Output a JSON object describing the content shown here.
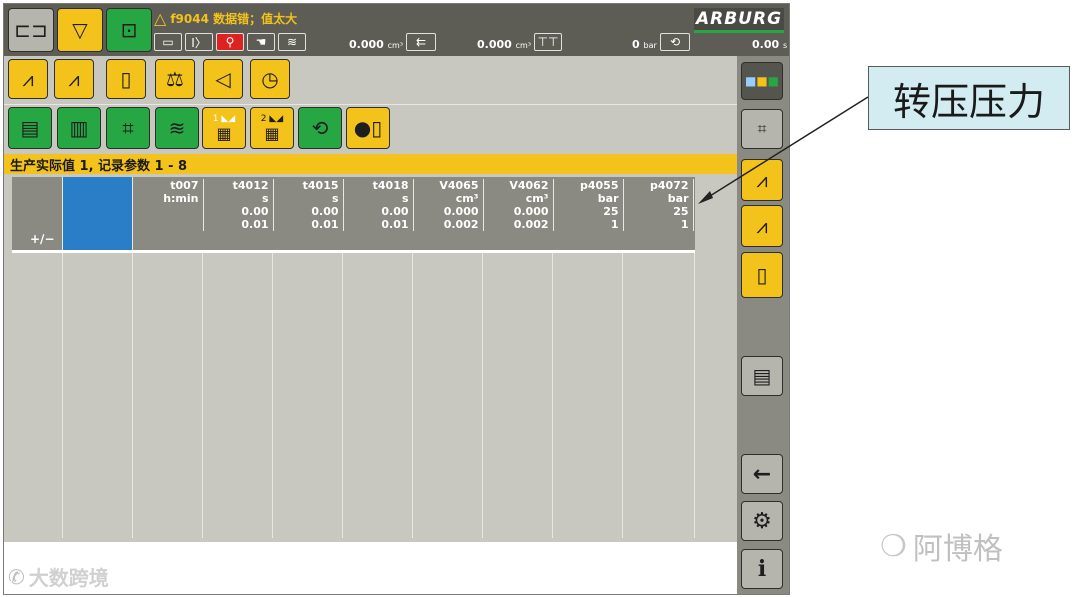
{
  "header": {
    "alarm_icon": "warning-triangle-icon",
    "alarm_text": "f9044 数据错；值太大",
    "brand": "ARBURG",
    "status_values": {
      "volume1": "0.000",
      "volume1_unit": "cm³",
      "volume2": "0.000",
      "volume2_unit": "cm³",
      "pressure": "0",
      "pressure_unit": "bar",
      "time": "0.00",
      "time_unit": "s"
    }
  },
  "toolbar": {
    "row1_icons": [
      "injection-curve-icon",
      "injection-curve-balance-icon",
      "document-icon",
      "balance-icon",
      "eye-icon",
      "clock-icon"
    ],
    "row2_icons": [
      "doc-list-icon",
      "doc-stack-icon",
      "doc-nodes-icon",
      "doc-curves-icon",
      "table-1-icon",
      "table-2-icon",
      "doc-cycle-icon",
      "record-icon"
    ],
    "table1_label": "1 ◣◢",
    "table2_label": "2 ◣◢"
  },
  "section": {
    "title": "生产实际值 1, 记录参数 1 - 8"
  },
  "table": {
    "first_cell": "+∕−",
    "columns": [
      {
        "name": "t007",
        "unit": "h:min",
        "val1": "",
        "val2": ""
      },
      {
        "name": "t4012",
        "unit": "s",
        "val1": "0.00",
        "val2": "0.01"
      },
      {
        "name": "t4015",
        "unit": "s",
        "val1": "0.00",
        "val2": "0.01"
      },
      {
        "name": "t4018",
        "unit": "s",
        "val1": "0.00",
        "val2": "0.01"
      },
      {
        "name": "V4065",
        "unit": "cm³",
        "val1": "0.000",
        "val2": "0.002"
      },
      {
        "name": "V4062",
        "unit": "cm³",
        "val1": "0.000",
        "val2": "0.002"
      },
      {
        "name": "p4055",
        "unit": "bar",
        "val1": "25",
        "val2": "1"
      },
      {
        "name": "p4072",
        "unit": "bar",
        "val1": "25",
        "val2": "1"
      }
    ]
  },
  "sidebar": {
    "icons": [
      "color-display-icon",
      "network-icon",
      "injection-curve-icon",
      "injection-curve-balance-icon",
      "document-icon",
      "chat-icon",
      "back-arrow-icon",
      "settings-gear-icon",
      "info-icon"
    ],
    "back_glyph": "←",
    "info_glyph": "i",
    "gear_glyph": "⚙"
  },
  "annotation": {
    "callout": "转压压力"
  },
  "watermarks": {
    "bottom_left": "大数跨境",
    "bottom_right": "阿博格"
  },
  "colors": {
    "accent_yellow": "#f3c21b",
    "accent_green": "#26a744",
    "panel_gray": "#c8c8c0",
    "header_dark": "#5d5d55",
    "selected_blue": "#2a7ec8"
  }
}
